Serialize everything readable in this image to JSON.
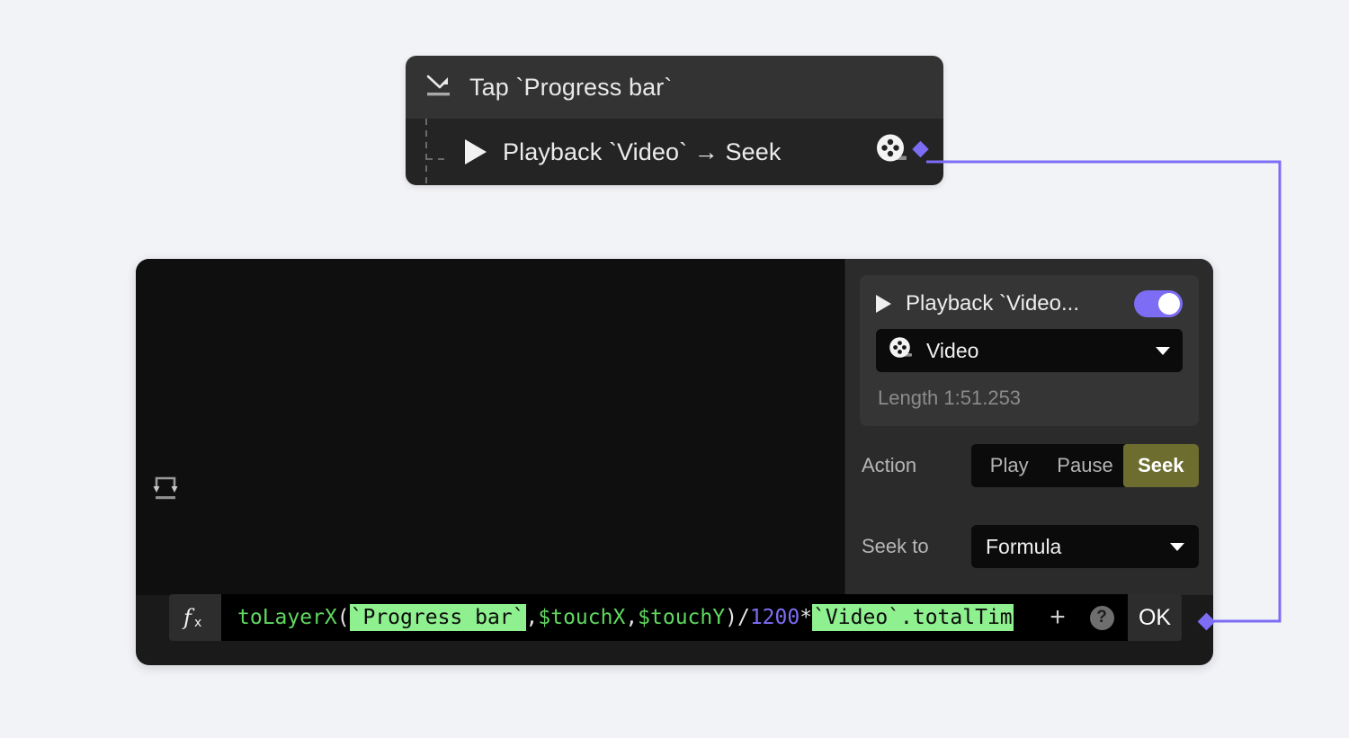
{
  "canvas": {
    "background_color": "#f2f3f7",
    "connector_color": "#7d6df4"
  },
  "action_card": {
    "trigger": {
      "icon": "tap-gesture-icon",
      "label": "Tap `Progress bar`"
    },
    "steps": [
      {
        "icon": "play-triangle-icon",
        "label": "Playback `Video` → Seek",
        "target_icon": "film-reel-icon",
        "connector_handle": "purple-diamond-handle"
      }
    ]
  },
  "editor": {
    "preview": {
      "loop_icon": "loop-repeat-icon",
      "background_color": "#0f0f0f"
    },
    "inspector": {
      "title": "Playback `Video...",
      "title_icon": "play-triangle-icon",
      "enabled_toggle": {
        "state": "on",
        "accent_color": "#7d6df4"
      },
      "layer_select": {
        "icon": "film-reel-icon",
        "value": "Video",
        "caret": "chevron-down-icon"
      },
      "length": "Length 1:51.253",
      "action": {
        "label": "Action",
        "options": [
          "Play",
          "Pause",
          "Seek"
        ],
        "selected": "Seek",
        "selected_color": "#6d6d2f"
      },
      "seek_to": {
        "label": "Seek to",
        "value": "Formula",
        "caret": "chevron-down-icon"
      }
    },
    "formula_bar": {
      "fx_icon": "fx-function-icon",
      "tokens": [
        {
          "text": "toLayerX",
          "type": "fn"
        },
        {
          "text": "(",
          "type": "punc"
        },
        {
          "text": "`Progress bar`",
          "type": "chip"
        },
        {
          "text": ",",
          "type": "punc"
        },
        {
          "text": "$touchX",
          "type": "var"
        },
        {
          "text": ",",
          "type": "punc"
        },
        {
          "text": "$touchY",
          "type": "var"
        },
        {
          "text": ")",
          "type": "punc"
        },
        {
          "text": "/",
          "type": "punc"
        },
        {
          "text": "1200",
          "type": "num"
        },
        {
          "text": "*",
          "type": "punc"
        },
        {
          "text": "`Video`.totalTim",
          "type": "chip"
        }
      ],
      "plus_label": "+",
      "help_label": "?",
      "ok_label": "OK",
      "connector_handle": "purple-diamond-handle"
    }
  }
}
